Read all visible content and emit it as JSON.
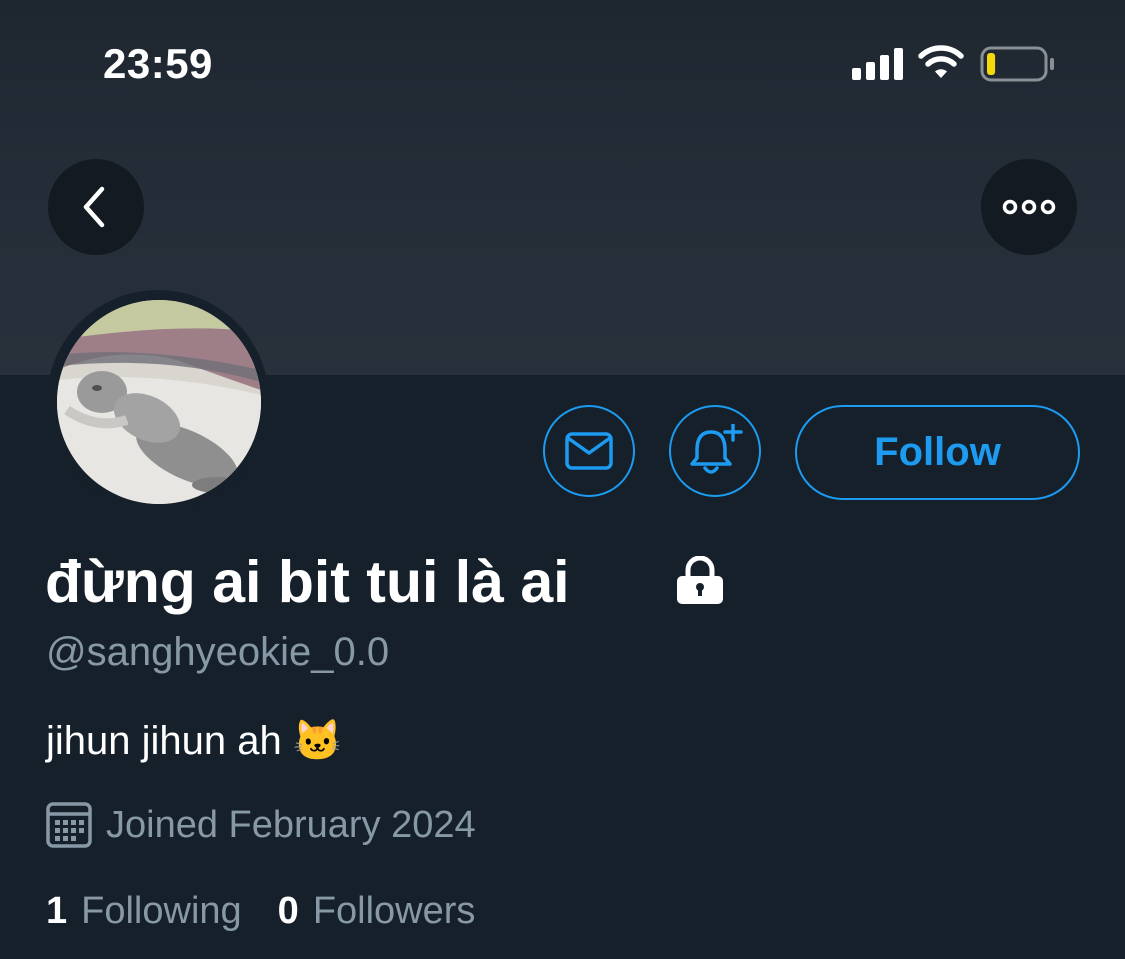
{
  "status_bar": {
    "time": "23:59",
    "icons": [
      "cellular-signal-icon",
      "wifi-icon",
      "battery-low-icon"
    ],
    "battery_level": 0.15,
    "battery_color": "#f5d90a"
  },
  "header": {
    "back_icon": "chevron-left-icon",
    "more_icon": "more-horizontal-icon"
  },
  "profile": {
    "display_name": "đừng ai bit tui là ai",
    "protected_icon": "lock-icon",
    "handle": "@sanghyeokie_0.0",
    "bio": "jihun jihun ah",
    "bio_emoji": "🐱",
    "joined": "Joined February 2024",
    "joined_icon": "calendar-icon"
  },
  "actions": {
    "message_icon": "mail-icon",
    "notify_icon": "bell-plus-icon",
    "follow_label": "Follow"
  },
  "stats": {
    "following_count": "1",
    "following_label": "Following",
    "followers_count": "0",
    "followers_label": "Followers"
  },
  "colors": {
    "background": "#15202b",
    "accent": "#1d9bf0",
    "secondary_text": "#8899a6"
  }
}
